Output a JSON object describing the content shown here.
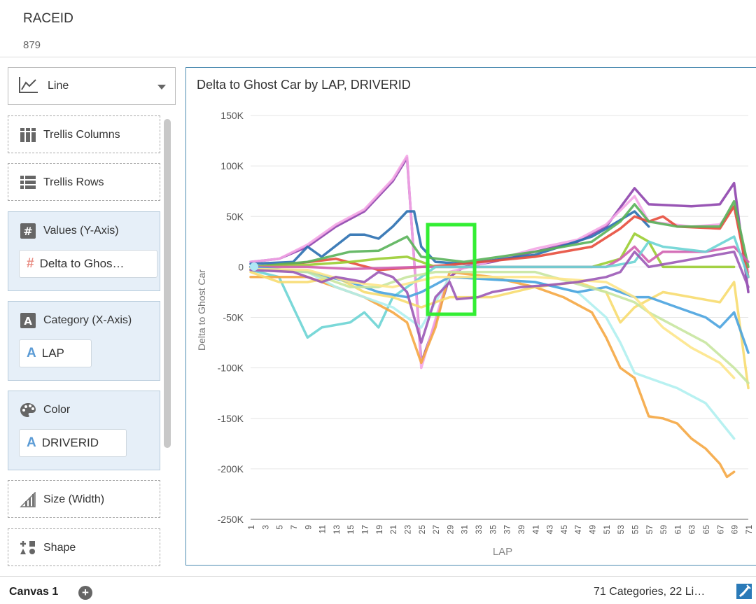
{
  "header": {
    "label": "RACEID",
    "value": "879"
  },
  "viz_type": {
    "label": "Line",
    "icon": "line-chart-icon"
  },
  "wells": {
    "trellis_columns": {
      "label": "Trellis Columns"
    },
    "trellis_rows": {
      "label": "Trellis Rows"
    },
    "values": {
      "label": "Values (Y-Axis)",
      "item": "Delta to Ghos…"
    },
    "category": {
      "label": "Category (X-Axis)",
      "item": "LAP"
    },
    "color": {
      "label": "Color",
      "item": "DRIVERID"
    },
    "size": {
      "label": "Size (Width)"
    },
    "shape": {
      "label": "Shape"
    }
  },
  "footer": {
    "canvas_tab": "Canvas 1",
    "add_label": "+",
    "status": "71 Categories, 22 Li…"
  },
  "colors": {
    "accent": "#4a8ab0",
    "well_fill": "#e6eff8",
    "highlight": "#33ee33"
  },
  "chart_data": {
    "type": "line",
    "title": "Delta to Ghost Car by LAP, DRIVERID",
    "xlabel": "LAP",
    "ylabel": "Delta to Ghost Car",
    "x_tick_labels": [
      "1",
      "3",
      "5",
      "7",
      "9",
      "11",
      "13",
      "15",
      "17",
      "19",
      "21",
      "23",
      "25",
      "27",
      "29",
      "31",
      "33",
      "35",
      "37",
      "39",
      "41",
      "43",
      "45",
      "47",
      "49",
      "51",
      "53",
      "55",
      "57",
      "59",
      "61",
      "63",
      "65",
      "67",
      "69",
      "71"
    ],
    "y_tick_labels": [
      "150K",
      "100K",
      "50K",
      "0",
      "-50K",
      "-100K",
      "-150K",
      "-200K",
      "-250K"
    ],
    "ylim": [
      -250000,
      150000
    ],
    "xlim": [
      1,
      71
    ],
    "grid": true,
    "series": [
      {
        "color": "#8e44ad",
        "points": [
          [
            1,
            5000
          ],
          [
            5,
            8000
          ],
          [
            9,
            20000
          ],
          [
            13,
            40000
          ],
          [
            17,
            55000
          ],
          [
            21,
            85000
          ],
          [
            23,
            108000
          ],
          [
            25,
            -95000
          ],
          [
            27,
            -55000
          ],
          [
            29,
            -10000
          ],
          [
            31,
            0
          ],
          [
            35,
            5000
          ],
          [
            41,
            15000
          ],
          [
            47,
            25000
          ],
          [
            51,
            40000
          ],
          [
            55,
            78000
          ],
          [
            57,
            62000
          ],
          [
            63,
            60000
          ],
          [
            67,
            62000
          ],
          [
            69,
            83000
          ],
          [
            71,
            -25000
          ]
        ]
      },
      {
        "color": "#f4a6e6",
        "points": [
          [
            1,
            5000
          ],
          [
            5,
            8000
          ],
          [
            9,
            22000
          ],
          [
            13,
            42000
          ],
          [
            17,
            57000
          ],
          [
            21,
            87000
          ],
          [
            23,
            110000
          ],
          [
            25,
            -100000
          ],
          [
            27,
            -52000
          ],
          [
            29,
            -5000
          ],
          [
            35,
            6000
          ],
          [
            41,
            18000
          ],
          [
            47,
            27000
          ],
          [
            51,
            42000
          ],
          [
            55,
            70000
          ],
          [
            57,
            45000
          ],
          [
            63,
            40000
          ],
          [
            67,
            42000
          ],
          [
            69,
            60000
          ],
          [
            71,
            -5000
          ]
        ]
      },
      {
        "color": "#2a6fb0",
        "points": [
          [
            1,
            3000
          ],
          [
            7,
            5000
          ],
          [
            9,
            20000
          ],
          [
            11,
            10000
          ],
          [
            15,
            32000
          ],
          [
            17,
            32000
          ],
          [
            19,
            28000
          ],
          [
            21,
            40000
          ],
          [
            23,
            55000
          ],
          [
            24,
            55000
          ],
          [
            25,
            20000
          ],
          [
            27,
            5000
          ],
          [
            31,
            3000
          ],
          [
            41,
            12000
          ],
          [
            49,
            30000
          ],
          [
            51,
            38000
          ],
          [
            55,
            55000
          ],
          [
            57,
            40000
          ]
        ]
      },
      {
        "color": "#e74c3c",
        "points": [
          [
            1,
            0
          ],
          [
            7,
            3000
          ],
          [
            13,
            8000
          ],
          [
            19,
            -3000
          ],
          [
            25,
            0
          ],
          [
            29,
            2000
          ],
          [
            41,
            10000
          ],
          [
            49,
            20000
          ],
          [
            53,
            38000
          ],
          [
            55,
            50000
          ],
          [
            57,
            45000
          ],
          [
            59,
            50000
          ],
          [
            61,
            40000
          ],
          [
            67,
            38000
          ],
          [
            69,
            60000
          ],
          [
            71,
            -10000
          ]
        ]
      },
      {
        "color": "#59b359",
        "points": [
          [
            1,
            0
          ],
          [
            9,
            5000
          ],
          [
            15,
            15000
          ],
          [
            19,
            16000
          ],
          [
            23,
            30000
          ],
          [
            25,
            10000
          ],
          [
            31,
            5000
          ],
          [
            41,
            15000
          ],
          [
            49,
            25000
          ],
          [
            53,
            45000
          ],
          [
            55,
            62000
          ],
          [
            57,
            45000
          ],
          [
            61,
            40000
          ],
          [
            67,
            40000
          ],
          [
            69,
            65000
          ],
          [
            71,
            0
          ]
        ]
      },
      {
        "color": "#9acd32",
        "points": [
          [
            1,
            0
          ],
          [
            9,
            2000
          ],
          [
            15,
            5000
          ],
          [
            19,
            8000
          ],
          [
            23,
            10000
          ],
          [
            27,
            0
          ],
          [
            41,
            0
          ],
          [
            49,
            0
          ],
          [
            53,
            8000
          ],
          [
            55,
            33000
          ],
          [
            57,
            25000
          ],
          [
            59,
            0
          ],
          [
            69,
            0
          ]
        ]
      },
      {
        "color": "#d060b0",
        "points": [
          [
            1,
            0
          ],
          [
            9,
            0
          ],
          [
            15,
            -2000
          ],
          [
            25,
            0
          ],
          [
            41,
            0
          ],
          [
            51,
            0
          ],
          [
            53,
            8000
          ],
          [
            55,
            20000
          ],
          [
            57,
            5000
          ],
          [
            59,
            15000
          ],
          [
            65,
            15000
          ],
          [
            69,
            20000
          ],
          [
            71,
            5000
          ]
        ]
      },
      {
        "color": "#6cd4d4",
        "points": [
          [
            1,
            -3000
          ],
          [
            5,
            -10000
          ],
          [
            7,
            -40000
          ],
          [
            9,
            -70000
          ],
          [
            11,
            -60000
          ],
          [
            15,
            -55000
          ],
          [
            17,
            -45000
          ],
          [
            19,
            -60000
          ],
          [
            21,
            -30000
          ],
          [
            23,
            -20000
          ],
          [
            25,
            -10000
          ],
          [
            27,
            0
          ],
          [
            41,
            0
          ],
          [
            51,
            0
          ],
          [
            55,
            5000
          ],
          [
            57,
            25000
          ],
          [
            59,
            20000
          ],
          [
            65,
            15000
          ],
          [
            69,
            30000
          ],
          [
            71,
            -10000
          ]
        ]
      },
      {
        "color": "#f5a742",
        "points": [
          [
            1,
            -10000
          ],
          [
            5,
            -10000
          ],
          [
            9,
            -10000
          ],
          [
            13,
            -20000
          ],
          [
            17,
            -30000
          ],
          [
            21,
            -45000
          ],
          [
            23,
            -55000
          ],
          [
            25,
            -95000
          ],
          [
            27,
            -60000
          ],
          [
            29,
            -5000
          ],
          [
            35,
            -10000
          ],
          [
            41,
            -20000
          ],
          [
            45,
            -30000
          ],
          [
            49,
            -45000
          ],
          [
            51,
            -70000
          ],
          [
            53,
            -100000
          ],
          [
            55,
            -110000
          ],
          [
            57,
            -148000
          ],
          [
            59,
            -150000
          ],
          [
            61,
            -155000
          ],
          [
            63,
            -170000
          ],
          [
            65,
            -180000
          ],
          [
            67,
            -195000
          ],
          [
            68,
            -208000
          ],
          [
            69,
            -203000
          ]
        ]
      },
      {
        "color": "#b0f0f0",
        "points": [
          [
            1,
            -3000
          ],
          [
            9,
            -5000
          ],
          [
            13,
            -20000
          ],
          [
            17,
            -30000
          ],
          [
            21,
            -40000
          ],
          [
            25,
            -60000
          ],
          [
            29,
            -10000
          ],
          [
            41,
            -15000
          ],
          [
            47,
            -25000
          ],
          [
            51,
            -50000
          ],
          [
            53,
            -75000
          ],
          [
            55,
            -105000
          ],
          [
            57,
            -110000
          ],
          [
            61,
            -120000
          ],
          [
            65,
            -135000
          ],
          [
            69,
            -170000
          ]
        ]
      },
      {
        "color": "#f7dc6f",
        "points": [
          [
            1,
            -5000
          ],
          [
            5,
            -15000
          ],
          [
            9,
            -15000
          ],
          [
            13,
            -10000
          ],
          [
            17,
            -25000
          ],
          [
            21,
            -30000
          ],
          [
            25,
            -40000
          ],
          [
            29,
            -30000
          ],
          [
            35,
            -30000
          ],
          [
            41,
            -20000
          ],
          [
            47,
            -15000
          ],
          [
            51,
            -25000
          ],
          [
            53,
            -55000
          ],
          [
            55,
            -40000
          ],
          [
            59,
            -25000
          ],
          [
            67,
            -35000
          ],
          [
            69,
            -15000
          ],
          [
            71,
            -120000
          ]
        ]
      },
      {
        "color": "#4aa3df",
        "points": [
          [
            1,
            0
          ],
          [
            9,
            -5000
          ],
          [
            15,
            -15000
          ],
          [
            19,
            -25000
          ],
          [
            23,
            -30000
          ],
          [
            25,
            -25000
          ],
          [
            29,
            -10000
          ],
          [
            41,
            -15000
          ],
          [
            47,
            -25000
          ],
          [
            51,
            -20000
          ],
          [
            53,
            -25000
          ],
          [
            55,
            -30000
          ],
          [
            57,
            -30000
          ],
          [
            61,
            -40000
          ],
          [
            65,
            -50000
          ],
          [
            67,
            -60000
          ],
          [
            69,
            -45000
          ],
          [
            71,
            -85000
          ]
        ]
      },
      {
        "color": "#c8e6a0",
        "points": [
          [
            1,
            -2000
          ],
          [
            9,
            -5000
          ],
          [
            15,
            -20000
          ],
          [
            19,
            -20000
          ],
          [
            23,
            -10000
          ],
          [
            27,
            -5000
          ],
          [
            41,
            -5000
          ],
          [
            51,
            -25000
          ],
          [
            55,
            -35000
          ],
          [
            57,
            -45000
          ],
          [
            61,
            -60000
          ],
          [
            65,
            -75000
          ],
          [
            69,
            -100000
          ],
          [
            71,
            -115000
          ]
        ]
      },
      {
        "color": "#fde68a",
        "points": [
          [
            1,
            -2000
          ],
          [
            9,
            -3000
          ],
          [
            15,
            -15000
          ],
          [
            21,
            -20000
          ],
          [
            27,
            -10000
          ],
          [
            41,
            -10000
          ],
          [
            51,
            -15000
          ],
          [
            55,
            -30000
          ],
          [
            59,
            -60000
          ],
          [
            63,
            -80000
          ],
          [
            67,
            -95000
          ],
          [
            69,
            -110000
          ]
        ]
      },
      {
        "color": "#9b59b6",
        "points": [
          [
            1,
            -3000
          ],
          [
            7,
            -5000
          ],
          [
            9,
            -10000
          ],
          [
            11,
            -15000
          ],
          [
            13,
            -10000
          ],
          [
            17,
            -15000
          ],
          [
            19,
            -5000
          ],
          [
            21,
            -10000
          ],
          [
            23,
            -25000
          ],
          [
            25,
            -75000
          ],
          [
            27,
            -30000
          ],
          [
            29,
            -15000
          ],
          [
            30,
            -32000
          ],
          [
            33,
            -30000
          ],
          [
            35,
            -25000
          ],
          [
            39,
            -20000
          ],
          [
            43,
            -18000
          ],
          [
            47,
            -15000
          ],
          [
            51,
            -10000
          ],
          [
            53,
            -5000
          ],
          [
            55,
            15000
          ],
          [
            57,
            0
          ],
          [
            69,
            15000
          ],
          [
            71,
            -20000
          ]
        ]
      }
    ]
  }
}
